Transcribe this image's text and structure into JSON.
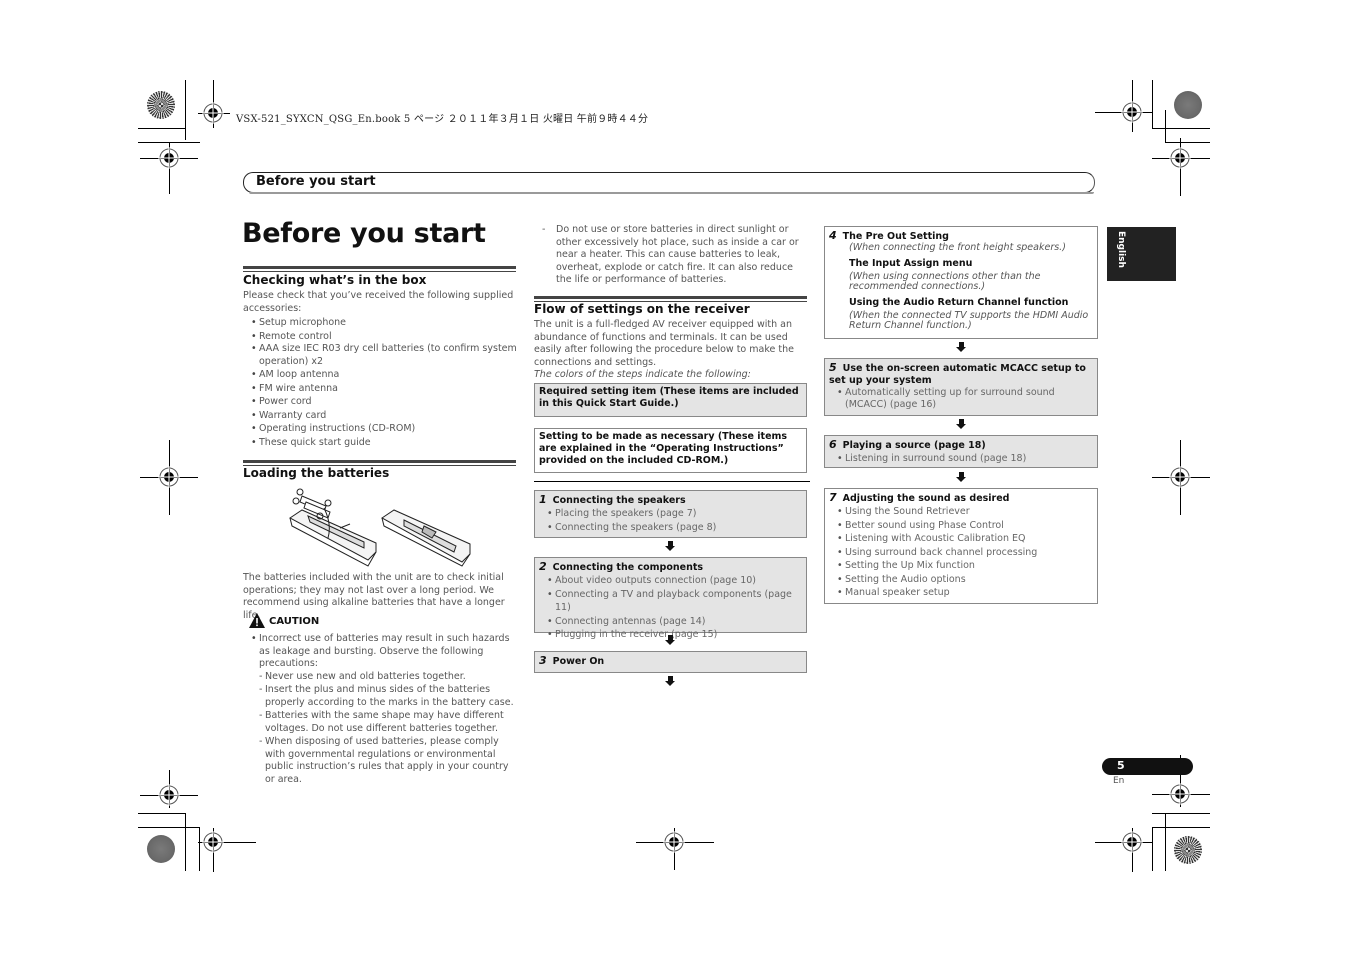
{
  "print_header": "VSX-521_SYXCN_QSG_En.book  5 ページ  ２０１１年３月１日  火曜日  午前９時４４分",
  "running_header": "Before you start",
  "page_title": "Before you start",
  "language_tab": "English",
  "page_number": "5",
  "page_language": "En",
  "icons": {
    "caution": "warning-triangle-icon",
    "flow_arrow": "down-arrow-icon",
    "registration": "crosshair-registration-icon"
  },
  "colors": {
    "required_box": "#e4e4e4",
    "optional_box": "#ffffff",
    "tab_bg": "#222222",
    "rule": "#444444"
  },
  "checking": {
    "title": "Checking what’s in the box",
    "intro": "Please check that you’ve received the following supplied accessories:",
    "items": [
      "Setup microphone",
      "Remote control",
      "AAA size IEC R03 dry cell batteries (to confirm system operation) x2",
      "AM loop antenna",
      "FM wire antenna",
      "Power cord",
      "Warranty card",
      "Operating instructions (CD-ROM)",
      "These quick start guide"
    ]
  },
  "batteries": {
    "title": "Loading the batteries",
    "figure": "remote-control-battery-illustration",
    "text": "The batteries included with the unit are to check initial operations; they may not last over a long period. We recommend using alkaline batteries that have a longer life.",
    "caution_label": "CAUTION",
    "caution_intro": "Incorrect use of batteries may result in such hazards as leakage and bursting. Observe the following precautions:",
    "precautions": [
      "Never use new and old batteries together.",
      "Insert the plus and minus sides of the batteries properly according to the marks in the battery case.",
      "Batteries with the same shape may have different voltages. Do not use different batteries together.",
      "When disposing of used batteries, please comply with governmental regulations or environmental public instruction’s rules that apply in your country or area.",
      "Do not use or store batteries in direct sunlight or other excessively hot place, such as inside a car or near a heater. This can cause batteries to leak, overheat, explode or catch fire. It can also reduce the life or performance of batteries."
    ]
  },
  "flow": {
    "title": "Flow of settings on the receiver",
    "intro": "The unit is a full-fledged AV receiver equipped with an abundance of functions and terminals. It can be used easily after following the procedure below to make the connections and settings.",
    "legend_note": "The colors of the steps indicate the following:",
    "legend_required": "Required setting item (These items are included in this Quick Start Guide.)",
    "legend_optional": "Setting to be made as necessary (These items are explained in the “Operating Instructions” provided on the included CD-ROM.)",
    "steps": [
      {
        "num": "1",
        "title": "Connecting the speakers",
        "type": "required",
        "items": [
          "Placing the speakers (page 7)",
          "Connecting the speakers (page 8)"
        ]
      },
      {
        "num": "2",
        "title": "Connecting the components",
        "type": "required",
        "items": [
          "About video outputs connection (page 10)",
          "Connecting a TV and playback components (page 11)",
          "Connecting antennas (page 14)",
          "Plugging in the receiver (page 15)"
        ]
      },
      {
        "num": "3",
        "title": "Power On",
        "type": "required",
        "items": []
      },
      {
        "num": "4",
        "title": "The Pre Out Setting",
        "type": "optional",
        "note": "(When connecting the front height speakers.)",
        "extra": [
          {
            "title": "The Input Assign menu",
            "note": "(When using connections other than the recommended connections.)"
          },
          {
            "title": "Using the Audio Return Channel function",
            "note": "(When the connected TV supports the HDMI Audio Return Channel function.)"
          }
        ]
      },
      {
        "num": "5",
        "title": "Use the on-screen automatic MCACC setup to set up your system",
        "type": "required",
        "items": [
          "Automatically setting up for surround sound (MCACC) (page 16)"
        ]
      },
      {
        "num": "6",
        "title": "Playing a source (page 18)",
        "type": "required",
        "items": [
          "Listening in surround sound (page 18)"
        ]
      },
      {
        "num": "7",
        "title": "Adjusting the sound as desired",
        "type": "optional",
        "items": [
          "Using the Sound Retriever",
          "Better sound using Phase Control",
          "Listening with Acoustic Calibration EQ",
          "Using surround back channel processing",
          "Setting the Up Mix function",
          "Setting the Audio options",
          "Manual speaker setup"
        ]
      }
    ]
  }
}
